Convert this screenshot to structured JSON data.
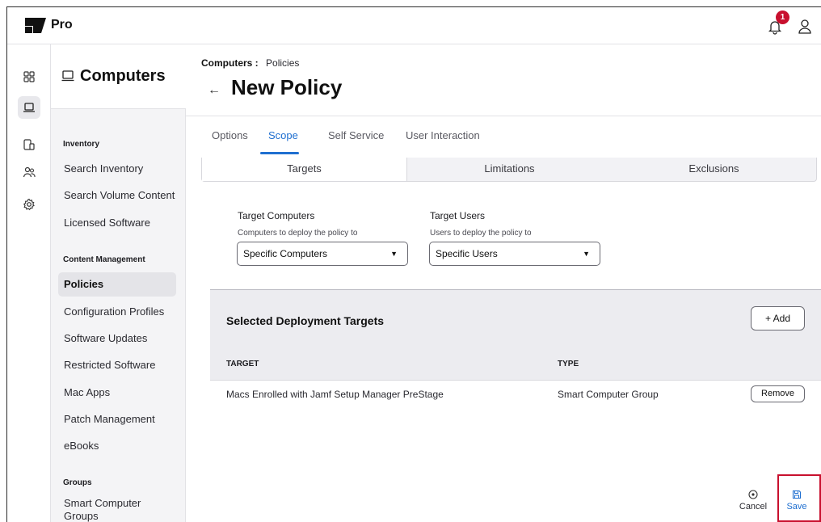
{
  "topbar": {
    "brand": "Pro",
    "notification_count": "1"
  },
  "sidebar": {
    "title": "Computers",
    "sections": {
      "inventory": "Inventory",
      "content_management": "Content Management",
      "groups": "Groups"
    },
    "items": {
      "search_inventory": "Search Inventory",
      "search_volume_content": "Search Volume Content",
      "licensed_software": "Licensed Software",
      "policies": "Policies",
      "configuration_profiles": "Configuration Profiles",
      "software_updates": "Software Updates",
      "restricted_software": "Restricted Software",
      "mac_apps": "Mac Apps",
      "patch_management": "Patch Management",
      "ebooks": "eBooks",
      "smart_computer_groups": "Smart Computer Groups"
    }
  },
  "main": {
    "breadcrumb_parent": "Computers :",
    "breadcrumb_current": "Policies",
    "title": "New Policy",
    "tabs": {
      "options": "Options",
      "scope": "Scope",
      "self_service": "Self Service",
      "user_interaction": "User Interaction"
    },
    "subtabs": {
      "targets": "Targets",
      "limitations": "Limitations",
      "exclusions": "Exclusions"
    },
    "target_computers": {
      "label": "Target Computers",
      "help": "Computers to deploy the policy to",
      "value": "Specific Computers"
    },
    "target_users": {
      "label": "Target Users",
      "help": "Users to deploy the policy to",
      "value": "Specific Users"
    },
    "deployment": {
      "title": "Selected Deployment Targets",
      "add_label": "+  Add",
      "col_target": "TARGET",
      "col_type": "TYPE",
      "rows": [
        {
          "target": "Macs Enrolled with Jamf Setup Manager PreStage",
          "type": "Smart Computer Group",
          "action": "Remove"
        }
      ]
    },
    "footer": {
      "cancel": "Cancel",
      "save": "Save"
    }
  },
  "colors": {
    "accent": "#1f6fd0",
    "badge": "#c8102e",
    "highlight": "#c8102e"
  }
}
